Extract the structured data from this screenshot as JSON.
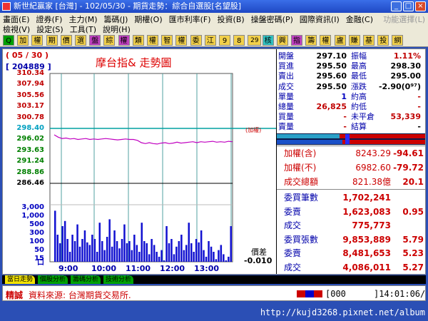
{
  "window": {
    "title": "新世紀贏家 [台灣] - 102/05/30 - 期貨走勢：綜合自選股[名望股]"
  },
  "menu": {
    "row1": [
      "畫面(E)",
      "證券(F)",
      "主力(M)",
      "籌碼(J)",
      "期權(O)",
      "匯市利率(F)",
      "投資(B)",
      "操盤密碼(P)",
      "國際資訊(I)",
      "金融(C)",
      "功能選擇(L)"
    ],
    "row2": [
      "檢視(V)",
      "設定(S)",
      "工具(T)",
      "說明(H)"
    ],
    "disabled": "功能選擇(L)"
  },
  "toolbar": {
    "buttons": [
      "Q",
      "加",
      "權",
      "期",
      "價",
      "選",
      "盤",
      "綜",
      "權",
      "類",
      "權",
      "智",
      "權",
      "委",
      "江",
      "9",
      "8",
      "29",
      "核",
      "興",
      "指",
      "籌",
      "權",
      "盧",
      "賺",
      "基",
      "投",
      "網"
    ]
  },
  "chart": {
    "date": "( 05 / 30 )",
    "code": "[ 204889 ]",
    "title": "摩台指&  走勢圖",
    "ref_label": "(加權)",
    "diff_title": "價差",
    "diff_value": "-0.010"
  },
  "chart_data": {
    "type": "line",
    "title": "摩台指&  走勢圖",
    "x_ticks": [
      "9:00",
      "10:00",
      "11:00",
      "12:00",
      "13:00"
    ],
    "y_ticks": [
      "310.34",
      "307.94",
      "305.56",
      "303.17",
      "300.78",
      "298.40",
      "296.02",
      "293.63",
      "291.24",
      "288.86",
      "286.46"
    ],
    "y_tick_colors": [
      "#c00000",
      "#c00000",
      "#c00000",
      "#c00000",
      "#c00000",
      "#00a0c0",
      "#008000",
      "#008000",
      "#008000",
      "#008000",
      "#000000"
    ],
    "ylim": [
      286.46,
      310.34
    ],
    "reference": 298.4,
    "series": [
      {
        "type": "line",
        "values": [
          297.0,
          296.5,
          296.2,
          296.3,
          296.1,
          296.2,
          296.0,
          296.1,
          296.2,
          296.0,
          296.1,
          296.0,
          296.1,
          296.2,
          296.1,
          296.0,
          295.9,
          296.0,
          296.1,
          296.0,
          296.0,
          295.8,
          295.3,
          295.1,
          295.3,
          295.1,
          295.0,
          295.2,
          295.3,
          295.1,
          295.2,
          295.4,
          295.2,
          295.3,
          295.4,
          295.5,
          295.3,
          295.5,
          295.4,
          295.5,
          295.6,
          295.4,
          295.5,
          295.4,
          295.6,
          295.5
        ]
      }
    ],
    "volume_ticks": [
      "3,000",
      "1,000",
      "500",
      "300",
      "100",
      "50",
      "15",
      "口"
    ],
    "volume": [
      2600,
      300,
      100,
      500,
      800,
      200,
      50,
      300,
      150,
      600,
      80,
      200,
      400,
      120,
      90,
      300,
      200,
      50,
      700,
      150,
      60,
      250,
      900,
      80,
      400,
      150,
      70,
      200,
      600,
      100,
      150,
      60,
      300,
      90,
      50,
      700,
      150,
      100,
      40,
      200,
      90,
      50,
      30,
      60,
      15,
      500,
      100,
      200,
      40,
      80,
      150,
      300,
      60,
      90,
      700,
      100,
      50,
      200,
      120,
      400,
      60,
      30,
      150,
      80,
      50,
      20,
      60,
      90,
      40,
      15,
      30,
      500
    ]
  },
  "quote": {
    "rows": [
      {
        "l1": "開盤",
        "v1": "297.10",
        "c1": "#000000",
        "l2": "振幅",
        "v2": "1.11%",
        "c2": "#c00000"
      },
      {
        "l1": "買進",
        "v1": "295.50",
        "c1": "#000000",
        "l2": "最高",
        "v2": "298.30",
        "c2": "#000000"
      },
      {
        "l1": "賣出",
        "v1": "295.60",
        "c1": "#000000",
        "l2": "最低",
        "v2": "295.00",
        "c2": "#000000"
      },
      {
        "l1": "成交",
        "v1": "295.50",
        "c1": "#000000",
        "l2": "漲跌",
        "v2": "-2.90(0⁹⁷)",
        "c2": "#000000"
      },
      {
        "l1": "單量",
        "v1": "1",
        "c1": "#0000c0",
        "l2": "約高",
        "v2": "-",
        "c2": "#c00000"
      },
      {
        "l1": "總量",
        "v1": "26,825",
        "c1": "#c00000",
        "l2": "約低",
        "v2": "-",
        "c2": "#c00000"
      },
      {
        "l1": "買量",
        "v1": "-",
        "c1": "#c00000",
        "l2": "未平倉",
        "v2": "53,339",
        "c2": "#c00000"
      },
      {
        "l1": "賣量",
        "v1": "-",
        "c1": "#c00000",
        "l2": "結算",
        "v2": "-",
        "c2": "#000000"
      }
    ]
  },
  "index": [
    {
      "label": "加權(含)",
      "value": "8243.29",
      "change": "-94.61"
    },
    {
      "label": "加權(不)",
      "value": "6982.60",
      "change": "-79.72"
    },
    {
      "label": "成交總額",
      "value": "821.38億",
      "change": "20.1"
    }
  ],
  "orders": [
    {
      "label": "委買筆數",
      "value": "1,702,241",
      "change": ""
    },
    {
      "label": "委賣",
      "value": "1,623,083",
      "change": "0.95"
    },
    {
      "label": "成交",
      "value": "775,773",
      "change": ""
    },
    {
      "label": "委買張數",
      "value": "9,853,889",
      "change": "5.79"
    },
    {
      "label": "委賣",
      "value": "8,481,653",
      "change": "5.23"
    },
    {
      "label": "成交",
      "value": "4,086,011",
      "change": "5.27"
    }
  ],
  "tabs": [
    {
      "label": "當日走勢",
      "active": true
    },
    {
      "label": "個股分析",
      "active": false
    },
    {
      "label": "籌碼分析",
      "active": false
    },
    {
      "label": "技術分析",
      "active": false
    }
  ],
  "status": {
    "label": "精誠",
    "source": "資料來源: 台灣期貨交易所.",
    "code": "[000",
    "time": "]14:01:06/"
  },
  "watermark_url": "http://kujd3268.pixnet.net/album"
}
